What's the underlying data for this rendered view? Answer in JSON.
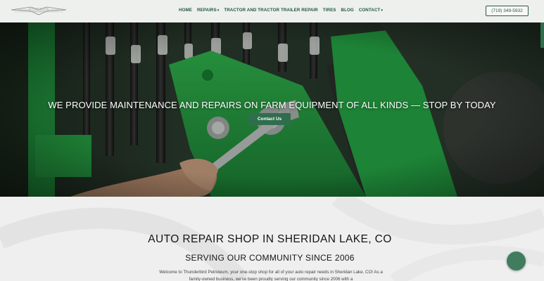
{
  "header": {
    "nav": [
      {
        "label": "HOME",
        "has_dropdown": false
      },
      {
        "label": "REPAIRS",
        "has_dropdown": true
      },
      {
        "label": "TRACTOR AND TRACTOR TRAILER REPAIR",
        "has_dropdown": false
      },
      {
        "label": "TIRES",
        "has_dropdown": false
      },
      {
        "label": "BLOG",
        "has_dropdown": false
      },
      {
        "label": "CONTACT",
        "has_dropdown": true
      }
    ],
    "phone": "(719) 349-5932"
  },
  "hero": {
    "headline": "WE PROVIDE MAINTENANCE AND REPAIRS ON FARM EQUIPMENT OF ALL KINDS — STOP BY TODAY",
    "cta_label": "Contact Us"
  },
  "content": {
    "heading": "AUTO REPAIR SHOP IN SHERIDAN LAKE, CO",
    "subheading": "SERVING OUR COMMUNITY SINCE 2006",
    "paragraph": "Welcome to Thunderbird Petroleum, your one-stop shop for all of your auto repair needs in Sheridan Lake, CO! As a family-owned business, we've been proudly serving our community since 2006 with a"
  },
  "colors": {
    "brand_green": "#2f6e4d",
    "nav_text": "#1e5a36"
  },
  "icons": {
    "caret": "▾"
  }
}
